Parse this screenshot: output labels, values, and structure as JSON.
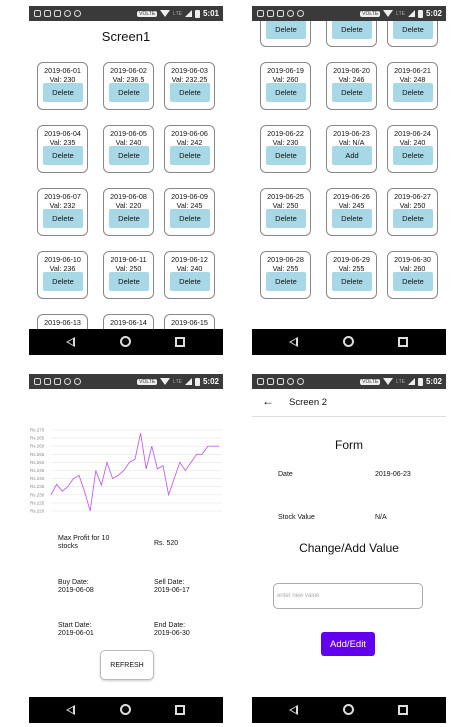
{
  "status_bar": {
    "times": [
      "5:01",
      "5:02",
      "5:02",
      "5:02"
    ],
    "chip": "VOLTE",
    "network": "LTE"
  },
  "screen1": {
    "title": "Screen1",
    "cards_top": [
      {
        "date": "2019-06-01",
        "val": "Val: 230",
        "action": "Delete"
      },
      {
        "date": "2019-06-02",
        "val": "Val: 236.5",
        "action": "Delete"
      },
      {
        "date": "2019-06-03",
        "val": "Val: 232.25",
        "action": "Delete"
      },
      {
        "date": "2019-06-04",
        "val": "Val: 235",
        "action": "Delete"
      },
      {
        "date": "2019-06-05",
        "val": "Val: 240",
        "action": "Delete"
      },
      {
        "date": "2019-06-06",
        "val": "Val: 242",
        "action": "Delete"
      },
      {
        "date": "2019-06-07",
        "val": "Val: 232",
        "action": "Delete"
      },
      {
        "date": "2019-06-08",
        "val": "Val: 220",
        "action": "Delete"
      },
      {
        "date": "2019-06-09",
        "val": "Val: 245",
        "action": "Delete"
      },
      {
        "date": "2019-06-10",
        "val": "Val: 236",
        "action": "Delete"
      },
      {
        "date": "2019-06-11",
        "val": "Val: 250",
        "action": "Delete"
      },
      {
        "date": "2019-06-12",
        "val": "Val: 240",
        "action": "Delete"
      },
      {
        "date": "2019-06-13",
        "val": "",
        "action": ""
      },
      {
        "date": "2019-06-14",
        "val": "",
        "action": ""
      },
      {
        "date": "2019-06-15",
        "val": "",
        "action": ""
      }
    ],
    "cards_bottom": [
      {
        "date": "",
        "val": "",
        "action": "Delete"
      },
      {
        "date": "",
        "val": "",
        "action": "Delete"
      },
      {
        "date": "",
        "val": "",
        "action": "Delete"
      },
      {
        "date": "2019-06-19",
        "val": "Val: 260",
        "action": "Delete"
      },
      {
        "date": "2019-06-20",
        "val": "Val: 246",
        "action": "Delete"
      },
      {
        "date": "2019-06-21",
        "val": "Val: 248",
        "action": "Delete"
      },
      {
        "date": "2019-06-22",
        "val": "Val: 230",
        "action": "Delete"
      },
      {
        "date": "2019-06-23",
        "val": "Val: N/A",
        "action": "Add"
      },
      {
        "date": "2019-06-24",
        "val": "Val: 240",
        "action": "Delete"
      },
      {
        "date": "2019-06-25",
        "val": "Val: 250",
        "action": "Delete"
      },
      {
        "date": "2019-06-26",
        "val": "Val: 245",
        "action": "Delete"
      },
      {
        "date": "2019-06-27",
        "val": "Val: 250",
        "action": "Delete"
      },
      {
        "date": "2019-06-28",
        "val": "Val: 255",
        "action": "Delete"
      },
      {
        "date": "2019-06-29",
        "val": "Val: 255",
        "action": "Delete"
      },
      {
        "date": "2019-06-30",
        "val": "Val: 260",
        "action": "Delete"
      }
    ]
  },
  "stats": {
    "max_profit_label": "Max Profit for 10 stocks",
    "max_profit_value": "Rs. 520",
    "buy_label": "Buy Date:",
    "buy_value": "2019-06-08",
    "sell_label": "Sell Date:",
    "sell_value": "2019-06-17",
    "start_label": "Start Date:",
    "start_value": "2019-06-01",
    "end_label": "End Date:",
    "end_value": "2019-06-30",
    "refresh_label": "REFRESH"
  },
  "form": {
    "appbar_title": "Screen 2",
    "heading": "Form",
    "date_label": "Date",
    "date_value": "2019-06-23",
    "stock_label": "Stock Value",
    "stock_value": "N/A",
    "change_heading": "Change/Add Value",
    "placeholder": "enter new value",
    "button_label": "Add/Edit"
  },
  "chart_data": {
    "type": "line",
    "title": "",
    "y_tick_labels": [
      "Rs.270",
      "Rs.265",
      "Rs.260",
      "Rs.255",
      "Rs.250",
      "Rs.245",
      "Rs.240",
      "Rs.235",
      "Rs.230",
      "Rs.225",
      "Rs.220"
    ],
    "ylim": [
      220,
      270
    ],
    "grid": true,
    "line_color": "#c060e8",
    "values": [
      230,
      236.5,
      232.25,
      235,
      240,
      242,
      232,
      220,
      245,
      236,
      250,
      240,
      242,
      245,
      250,
      252,
      268,
      246,
      260,
      246,
      248,
      230,
      240,
      250,
      245,
      250,
      255,
      255,
      260,
      260,
      260
    ]
  }
}
